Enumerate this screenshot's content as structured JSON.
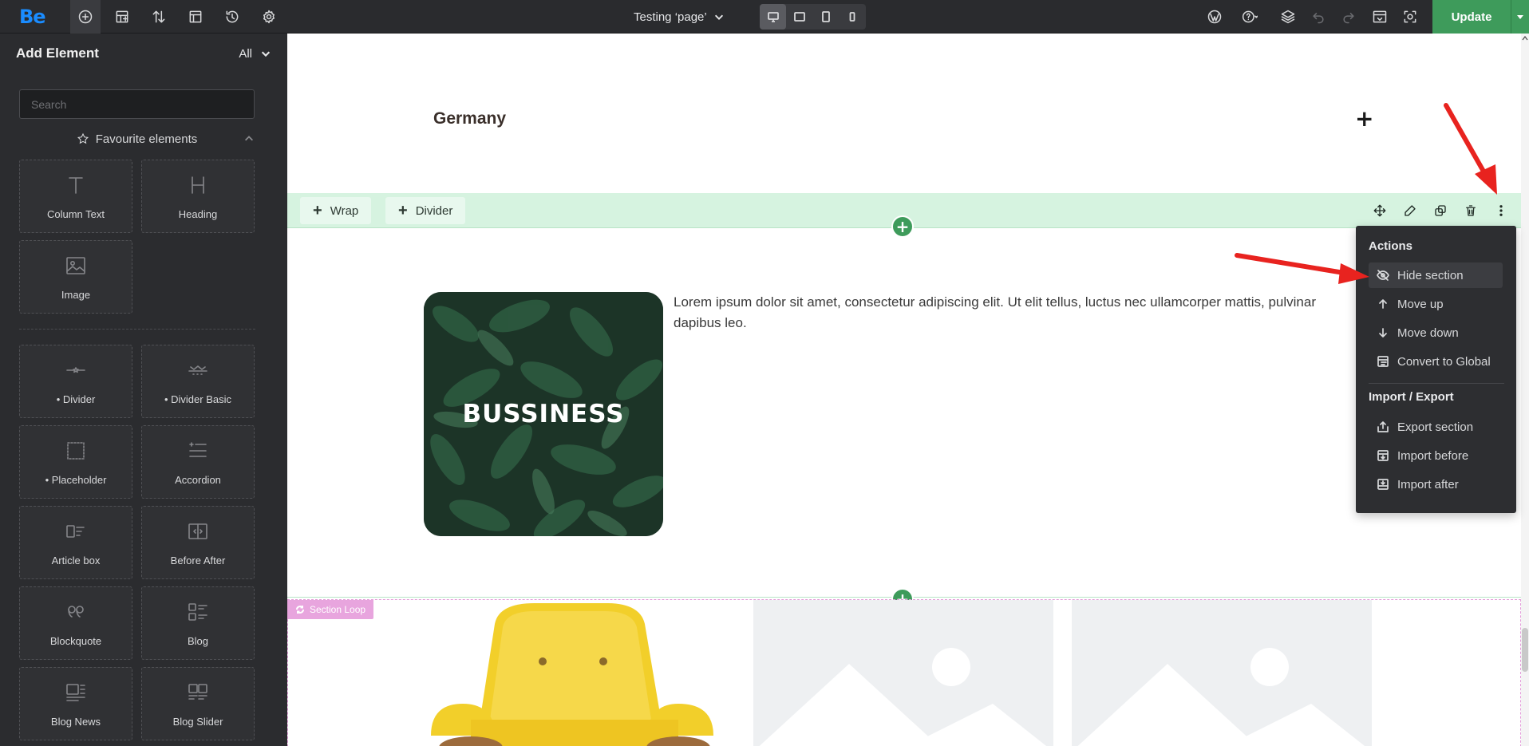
{
  "toolbar": {
    "logo": "Be",
    "page_title": "Testing ‘page’",
    "update_label": "Update",
    "icons": [
      "add-icon",
      "layout-icon",
      "sort-icon",
      "template-icon",
      "history-icon",
      "settings-icon"
    ],
    "devices": [
      "desktop-icon",
      "tablet-landscape-icon",
      "tablet-portrait-icon",
      "mobile-icon"
    ],
    "right_icons": [
      "wordpress-icon",
      "help-icon",
      "layers-icon",
      "undo-icon",
      "redo-icon",
      "preview-icon",
      "screenshot-icon"
    ]
  },
  "sidebar": {
    "title": "Add Element",
    "filter": "All",
    "search_placeholder": "Search",
    "favourites_label": "Favourite elements",
    "favourites": [
      {
        "label": "Column Text",
        "icon": "text-icon"
      },
      {
        "label": "Heading",
        "icon": "heading-icon"
      },
      {
        "label": "Image",
        "icon": "image-icon"
      }
    ],
    "elements": [
      {
        "label": "• Divider",
        "icon": "divider-icon"
      },
      {
        "label": "• Divider Basic",
        "icon": "divider-basic-icon"
      },
      {
        "label": "• Placeholder",
        "icon": "placeholder-icon"
      },
      {
        "label": "Accordion",
        "icon": "accordion-icon"
      },
      {
        "label": "Article box",
        "icon": "article-box-icon"
      },
      {
        "label": "Before After",
        "icon": "before-after-icon"
      },
      {
        "label": "Blockquote",
        "icon": "blockquote-icon"
      },
      {
        "label": "Blog",
        "icon": "blog-icon"
      },
      {
        "label": "Blog News",
        "icon": "blog-news-icon"
      },
      {
        "label": "Blog Slider",
        "icon": "blog-slider-icon"
      }
    ]
  },
  "canvas": {
    "accordion_title": "Germany",
    "accordion_toggle": "+",
    "wrap_bar": {
      "wrap_label": "Wrap",
      "divider_label": "Divider"
    },
    "image_text": "BUSSINESS",
    "lorem": "Lorem ipsum dolor sit amet, consectetur adipiscing elit. Ut elit tellus, luctus nec ullamcorper mattis, pulvinar dapibus leo.",
    "loop_label": "Section Loop"
  },
  "actions_menu": {
    "actions_heading": "Actions",
    "items": [
      "Hide section",
      "Move up",
      "Move down",
      "Convert to Global"
    ],
    "import_export_heading": "Import / Export",
    "io_items": [
      "Export section",
      "Import before",
      "Import after"
    ]
  },
  "colors": {
    "accent": "#3e9b5b",
    "brand": "#1a8cff",
    "arrow": "#e8231f",
    "loop": "#e8a5de"
  }
}
